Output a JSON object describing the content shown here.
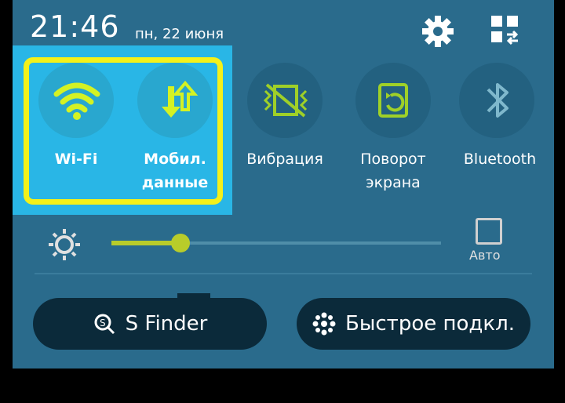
{
  "status": {
    "time": "21:46",
    "date": "пн, 22 июня"
  },
  "tiles": [
    {
      "label_lines": [
        "Wi-Fi"
      ],
      "icon": "wifi-icon",
      "active": true
    },
    {
      "label_lines": [
        "Мобил.",
        "данные"
      ],
      "icon": "mobile-data-icon",
      "active": true
    },
    {
      "label_lines": [
        "Вибрация"
      ],
      "icon": "vibration-icon",
      "active": false
    },
    {
      "label_lines": [
        "Поворот",
        "экрана"
      ],
      "icon": "rotate-icon",
      "active": false
    },
    {
      "label_lines": [
        "Bluetooth"
      ],
      "icon": "bluetooth-icon",
      "active": false
    }
  ],
  "brightness": {
    "level": 0.21,
    "auto_label": "Авто"
  },
  "bottom": {
    "sfinder_label": "S Finder",
    "quickconnect_label": "Быстрое подкл."
  },
  "colors": {
    "accent": "#b8cc2a",
    "highlight": "#29b6e6",
    "frame": "#f3f11a",
    "panel": "#2a6b8c"
  }
}
